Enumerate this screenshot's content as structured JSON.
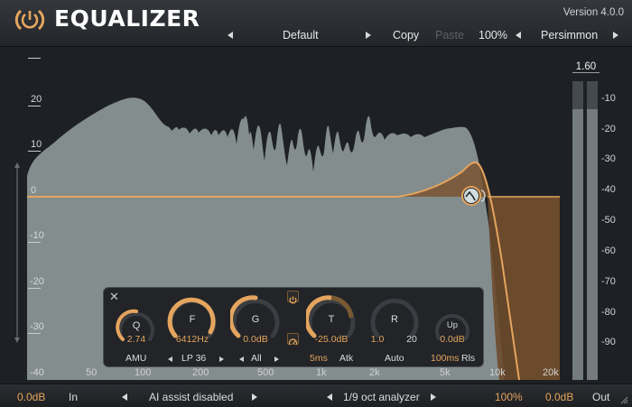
{
  "header": {
    "title": "EQUALIZER",
    "version": "Version 4.0.0",
    "preset": "Default",
    "copy": "Copy",
    "paste": "Paste",
    "zoom": "100%",
    "theme": "Persimmon"
  },
  "graph": {
    "db_labels": [
      "20",
      "10",
      "0",
      "-10",
      "-20",
      "-30",
      "-40"
    ],
    "freq_labels": [
      "50",
      "100",
      "200",
      "500",
      "1k",
      "2k",
      "5k",
      "10k",
      "20k"
    ]
  },
  "meter": {
    "peak": "1.60",
    "scale": [
      "-10",
      "-20",
      "-30",
      "-40",
      "-50",
      "-60",
      "-70",
      "-80",
      "-90"
    ],
    "left_level": 0.905,
    "right_level": 0.905
  },
  "band": {
    "q": {
      "label": "Q",
      "value": "2.74"
    },
    "f": {
      "label": "F",
      "value": "6412Hz"
    },
    "g": {
      "label": "G",
      "value": "0.0dB"
    },
    "t": {
      "label": "T",
      "value": "-25.0dB"
    },
    "r": {
      "label": "R",
      "value_left": "1.0",
      "value_right": "20"
    },
    "up": {
      "label": "Up",
      "value": "0.0dB"
    },
    "mode": "AMU",
    "filter_type": "LP 36",
    "channel": "All",
    "attack": "5ms",
    "attack_label": "Atk",
    "auto": "Auto",
    "release": "100ms",
    "release_label": "Rls"
  },
  "footer": {
    "in_gain": "0.0dB",
    "in_label": "In",
    "ai_assist": "AI assist disabled",
    "analyzer": "1/9 oct analyzer",
    "mix": "100%",
    "out_gain": "0.0dB",
    "out_label": "Out"
  },
  "colors": {
    "accent": "#e5a55e",
    "spectrum": "#8d9797",
    "eq_fill": "#7a5430",
    "background": "#1d2024"
  }
}
